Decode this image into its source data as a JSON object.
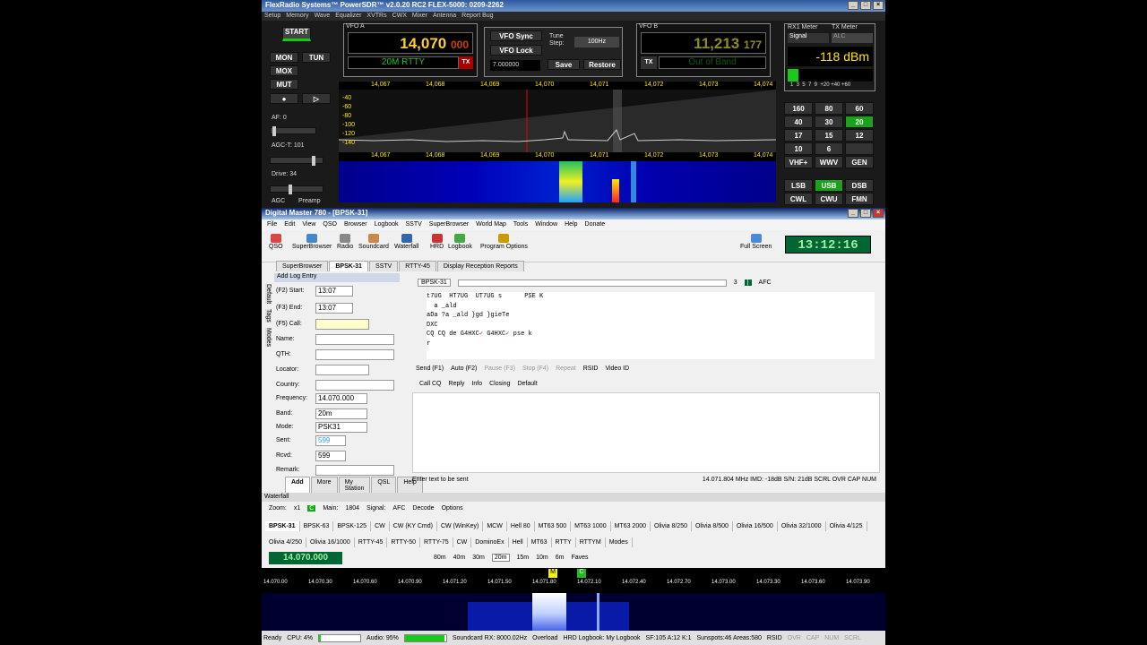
{
  "psdr": {
    "title": "FlexRadio Systems™ PowerSDR™ v2.0.20 RC2   FLEX-5000: 0209-2262",
    "menu": [
      "Setup",
      "Memory",
      "Wave",
      "Equalizer",
      "XVTRs",
      "CWX",
      "Mixer",
      "Antenna",
      "Report Bug"
    ],
    "start": "START",
    "mon": "MON",
    "tun": "TUN",
    "mox": "MOX",
    "mut": "MUT",
    "af": "AF:  0",
    "agct": "AGC-T:  101",
    "drive": "Drive:  34",
    "agc": "AGC",
    "preamp": "Preamp",
    "vfoa_label": "VFO A",
    "vfoa_freq": "14,070",
    "vfoa_sub": "000",
    "vfoa_mode": "20M RTTY",
    "tx": "TX",
    "vfo_sync": "VFO Sync",
    "vfo_lock": "VFO Lock",
    "tune_step_label": "Tune Step:",
    "tune_step": "100Hz",
    "vfo_mem": "7.000000",
    "save": "Save",
    "restore": "Restore",
    "vfob_label": "VFO B",
    "vfob_freq": "11,213",
    "vfob_sub": "177",
    "vfob_mode": "Out of Band",
    "rx1meter": "RX1 Meter",
    "txmeter": "TX Meter",
    "meter_sel": "Signal",
    "tx_sel": "ALC",
    "dbm": "-118 dBm",
    "meter_scale": "1  3  5  7  9  +20 +40 +60",
    "bands": [
      "160",
      "80",
      "60",
      "40",
      "30",
      "20",
      "17",
      "15",
      "12",
      "10",
      "6",
      "",
      "VHF+",
      "WWV",
      "GEN"
    ],
    "active_band": "20",
    "modes": [
      "LSB",
      "USB",
      "DSB",
      "CWL",
      "CWU",
      "FMN"
    ],
    "active_mode": "USB",
    "pan_ticks": [
      "14,067",
      "14,068",
      "14,069",
      "14,070",
      "14,071",
      "14,072",
      "14,073",
      "14,074"
    ],
    "db_ticks": [
      "-40",
      "-60",
      "-80",
      "-100",
      "-120",
      "-140"
    ]
  },
  "dm": {
    "title": "Digital Master 780 - [BPSK-31]",
    "menu": [
      "File",
      "Edit",
      "View",
      "QSO",
      "Browser",
      "Logbook",
      "SSTV",
      "SuperBrowser",
      "World Map",
      "Tools",
      "Window",
      "Help",
      "Donate"
    ],
    "toolbar": [
      "QSO",
      "SuperBrowser",
      "Radio",
      "Soundcard",
      "Waterfall",
      "HRD",
      "Logbook",
      "Program Options"
    ],
    "fullscreen": "Full Screen",
    "clock": "13:12:16",
    "tabs": [
      "SuperBrowser",
      "BPSK-31",
      "SSTV",
      "RTTY-45",
      "Display Reception Reports"
    ],
    "log": {
      "header": "Add Log Entry",
      "start_lbl": "(F2) Start:",
      "start": "13:07",
      "end_lbl": "(F3) End:",
      "end": "13:07",
      "call_lbl": "(F5) Call:",
      "name_lbl": "Name:",
      "qth_lbl": "QTH:",
      "loc_lbl": "Locator:",
      "country_lbl": "Country:",
      "freq_lbl": "Frequency:",
      "freq": "14.070.000",
      "band_lbl": "Band:",
      "band": "20m",
      "mode_lbl": "Mode:",
      "mode": "PSK31",
      "sent_lbl": "Sent:",
      "sent": "599",
      "rcvd_lbl": "Rcvd:",
      "rcvd": "599",
      "remark_lbl": "Remark:",
      "btns": [
        "Add",
        "More",
        "My Station",
        "QSL",
        "Help"
      ],
      "side_tabs": [
        "Default",
        "Tags",
        "Modes"
      ]
    },
    "psk_sel": "BPSK-31",
    "afc": "AFC",
    "psk_num": "3",
    "rx_lines": [
      "t7UG  HT7UG  UT7UG s      PSE K",
      "  a _ald",
      "aDa ?a _ald }gd }gieTe",
      "DXC",
      "CQ CQ de G4HXC",
      "r"
    ],
    "rx_line5b": " G4HXC",
    "rx_line5c": " pse k",
    "tx_bar": [
      "Send (F1)",
      "Auto (F2)",
      "Pause (F3)",
      "Stop (F4)",
      "Repeat",
      "RSID",
      "Video ID"
    ],
    "macros": [
      "Call CQ",
      "Reply",
      "Info",
      "Closing",
      "Default"
    ],
    "status": "Enter text to be sent",
    "status_right": "14.071.804 MHz   IMD: -18dB   S/N: 21dB   SCRL   OVR   CAP   NUM"
  },
  "wf": {
    "title": "Waterfall",
    "zoom_lbl": "Zoom:",
    "zoom": "x1",
    "main_lbl": "Main:",
    "main": "1804",
    "signal_lbl": "Signal:",
    "afc": "AFC",
    "decode": "Decode",
    "options": "Options",
    "modes1": [
      "BPSK-31",
      "BPSK-63",
      "BPSK-125",
      "CW",
      "CW (KY Cmd)",
      "CW (WinKey)",
      "MCW",
      "Hell 80",
      "MT63 500",
      "MT63 1000",
      "MT63 2000",
      "Olivia 8/250",
      "Olivia 8/500",
      "Olivia 16/500",
      "Olivia 32/1000",
      "Olivia 4/125"
    ],
    "modes2": [
      "Olivia 4/250",
      "Olivia 16/1000",
      "RTTY-45",
      "RTTY-50",
      "RTTY-75",
      "CW",
      "DominoEx",
      "Hell",
      "MT63",
      "RTTY",
      "RTTYM",
      "Modes"
    ],
    "freq": "14.070.000",
    "bands": [
      "80m",
      "40m",
      "30m",
      "20m",
      "15m",
      "10m",
      "6m",
      "Faves"
    ],
    "scale": [
      "14.070.00",
      "14.070.30",
      "14.070.60",
      "14.070.90",
      "14.071.20",
      "14.071.50",
      "14.071.80",
      "14.072.10",
      "14.072.40",
      "14.072.70",
      "14.073.00",
      "14.073.30",
      "14.073.60",
      "14.073.90"
    ]
  },
  "statusbar": {
    "ready": "Ready",
    "cpu": "CPU: 4%",
    "cpu_pct": 4,
    "audio": "Audio: 95%",
    "audio_pct": 95,
    "sc": "Soundcard RX: 8000.02Hz",
    "overload": "Overload",
    "hrd": "HRD Logbook: My Logbook",
    "sf": "SF:105 A:12 K:1",
    "sun": "Sunspots:46 Areas:580",
    "rsid": "RSID",
    "ovr": "OVR",
    "cap": "CAP",
    "num": "NUM",
    "scrl": "SCRL"
  },
  "colors": {
    "band_active": "#1aa31a",
    "vfo_digits": "#ffcc33",
    "clock_bg": "#006633"
  }
}
